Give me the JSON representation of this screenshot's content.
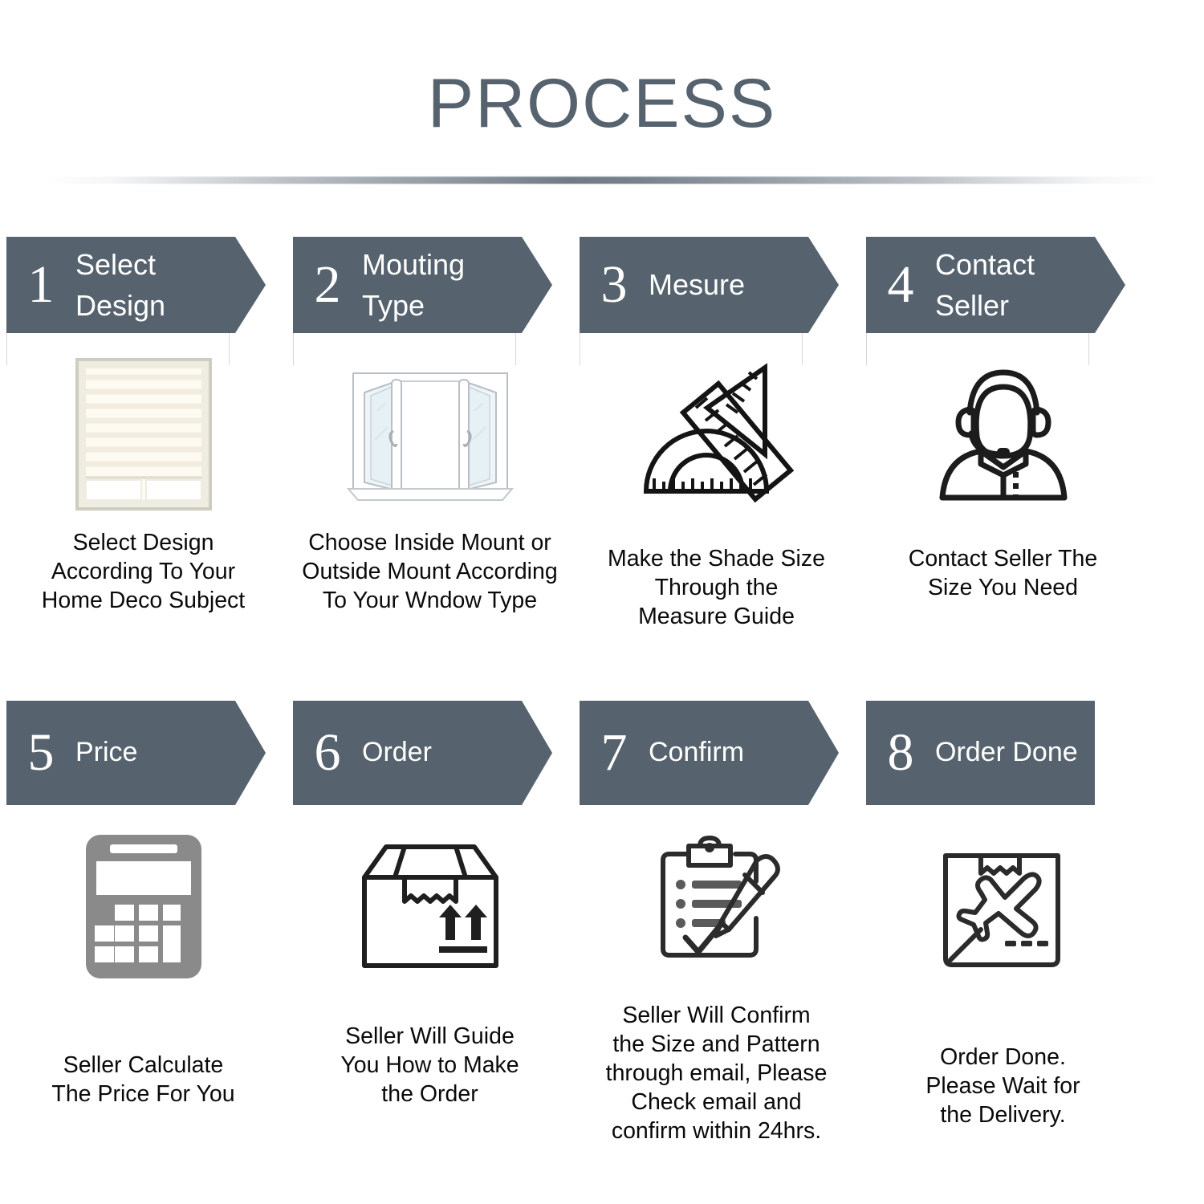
{
  "header": {
    "title": "PROCESS"
  },
  "steps": [
    {
      "number": "1",
      "label": "Select\nDesign",
      "icon": "window-blind-icon",
      "caption": "Select Design\nAccording To Your\nHome Deco Subject",
      "has_arrow": true
    },
    {
      "number": "2",
      "label": "Mouting\nType",
      "icon": "casement-window-icon",
      "caption": "Choose Inside Mount or\nOutside Mount According\nTo Your Wndow Type",
      "has_arrow": true
    },
    {
      "number": "3",
      "label": "Mesure",
      "icon": "ruler-protractor-icon",
      "caption": "Make the Shade Size\nThrough the\nMeasure Guide",
      "has_arrow": true
    },
    {
      "number": "4",
      "label": "Contact\nSeller",
      "icon": "headset-agent-icon",
      "caption": "Contact Seller The\nSize You Need",
      "has_arrow": true
    },
    {
      "number": "5",
      "label": "Price",
      "icon": "calculator-icon",
      "caption": "Seller Calculate\nThe Price For You",
      "has_arrow": true
    },
    {
      "number": "6",
      "label": "Order",
      "icon": "shipping-box-icon",
      "caption": "Seller Will Guide\nYou How to Make\nthe Order",
      "has_arrow": true
    },
    {
      "number": "7",
      "label": "Confirm",
      "icon": "clipboard-pen-icon",
      "caption": "Seller Will Confirm\nthe Size and Pattern\nthrough email, Please\nCheck email and\nconfirm within 24hrs.",
      "has_arrow": true
    },
    {
      "number": "8",
      "label": "Order Done",
      "icon": "air-delivery-icon",
      "caption": "Order Done.\nPlease Wait for\nthe Delivery.",
      "has_arrow": false
    }
  ],
  "colors": {
    "banner": "#56636e",
    "title": "#56636e",
    "caption": "#0a0a0a",
    "icon_line": "#1f1f1f",
    "calculator": "#8a8a8a",
    "blind_frame": "#cfccc2",
    "blind_fabric": "#fdf8ee",
    "background": "#ffffff"
  }
}
